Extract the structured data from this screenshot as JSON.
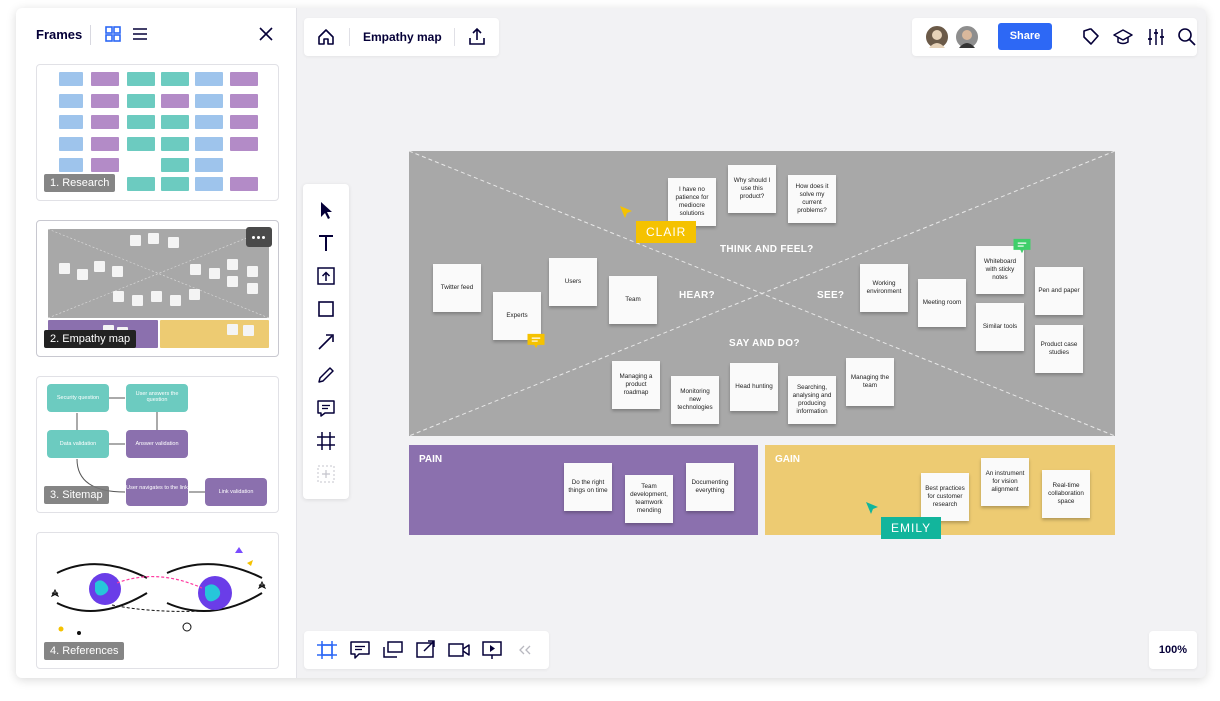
{
  "frames_panel": {
    "title": "Frames",
    "frames": [
      {
        "label": "1. Research"
      },
      {
        "label": "2. Empathy map"
      },
      {
        "label": "3. Sitemap",
        "nodes": [
          "Security question",
          "User answers the question",
          "Data validation",
          "Answer validation",
          "User navigates to the link",
          "Link validation"
        ]
      },
      {
        "label": "4. References"
      }
    ]
  },
  "topbar": {
    "board_name": "Empathy map",
    "share_label": "Share"
  },
  "zoom": {
    "level": "100%"
  },
  "board": {
    "quadrants": {
      "think_feel": "THINK AND FEEL?",
      "hear": "HEAR?",
      "see": "SEE?",
      "say_do": "SAY AND DO?"
    },
    "stickies": {
      "patience": "I have no patience for mediocre solutions",
      "why": "Why should I use this product?",
      "how": "How does it solve my current problems?",
      "twitter": "Twitter feed",
      "users": "Users",
      "experts": "Experts",
      "team": "Team",
      "working_env": "Working environment",
      "meeting": "Meeting room",
      "whiteboard": "Whiteboard with sticky notes",
      "pen_paper": "Pen and paper",
      "similar_tools": "Similar tools",
      "case_studies": "Product case studies",
      "managing_roadmap": "Managing a product roadmap",
      "monitoring": "Monitoring new technologies",
      "head_hunting": "Head hunting",
      "searching": "Searching, analysing and producing information",
      "managing_team": "Managing the team"
    },
    "pain": {
      "title": "PAIN",
      "stickies": [
        "Do the right things on time",
        "Team development, teamwork mending",
        "Documenting everything"
      ]
    },
    "gain": {
      "title": "GAIN",
      "stickies": [
        "Best practices for customer research",
        "An instrument for vision alignment",
        "Real-time collaboration space"
      ]
    },
    "cursors": [
      {
        "name": "CLAIR",
        "color": "#f5c200"
      },
      {
        "name": "EMILY",
        "color": "#12b59c"
      }
    ]
  },
  "colors": {
    "accent": "#2d68f5",
    "board_gray": "#a8a8a8",
    "pain": "#8b70ae",
    "gain": "#edcb72",
    "comment_yellow": "#f5c200",
    "comment_green": "#3fcf6a"
  },
  "icons": {
    "frames_header": [
      "grid-view-icon",
      "list-view-icon",
      "close-icon"
    ],
    "topbar": [
      "home-icon",
      "export-icon",
      "tag-icon",
      "learning-icon",
      "settings-icon",
      "search-icon"
    ],
    "tools": [
      "select-icon",
      "text-icon",
      "upload-icon",
      "shape-icon",
      "arrow-icon",
      "pen-icon",
      "comment-icon",
      "frame-icon",
      "add-icon"
    ],
    "bottom": [
      "frames-icon",
      "comments-icon",
      "cards-icon",
      "share-screen-icon",
      "video-icon",
      "present-icon",
      "collapse-icon"
    ]
  }
}
